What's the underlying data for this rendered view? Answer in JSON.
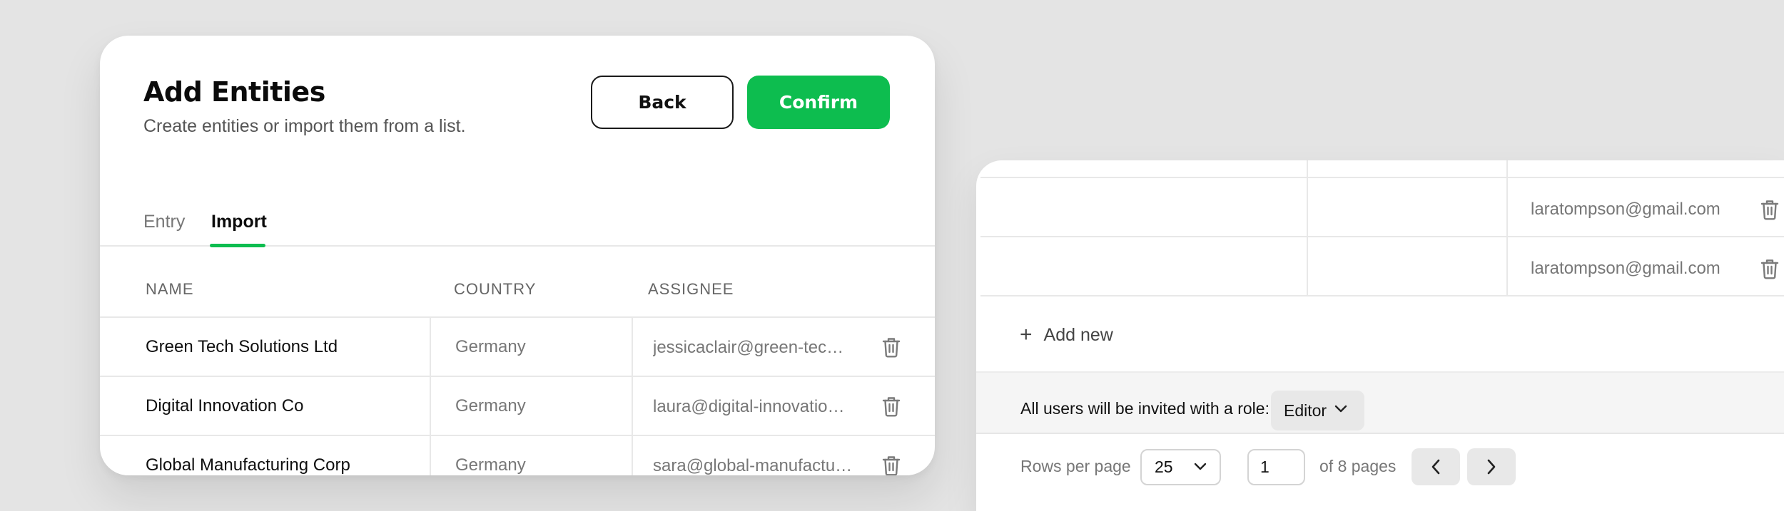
{
  "dialog": {
    "title": "Add Entities",
    "subtitle": "Create entities or import them from a list.",
    "back_label": "Back",
    "confirm_label": "Confirm",
    "tabs": [
      {
        "label": "Entry",
        "active": false
      },
      {
        "label": "Import",
        "active": true
      }
    ],
    "columns": [
      "NAME",
      "COUNTRY",
      "ASSIGNEE"
    ],
    "rows": [
      {
        "name": "Green Tech Solutions Ltd",
        "country": "Germany",
        "assignee": "jessicaclair@green-tech.com"
      },
      {
        "name": "Digital Innovation Co",
        "country": "Germany",
        "assignee": "laura@digital-innovation.com"
      },
      {
        "name": "Global Manufacturing Corp",
        "country": "Germany",
        "assignee": "sara@global-manufacturing.com"
      }
    ]
  },
  "invite_panel": {
    "rows": [
      {
        "email": "laratompson@gmail.com"
      },
      {
        "email": "laratompson@gmail.com"
      }
    ],
    "add_new_label": "Add new",
    "role_prompt": "All users will be invited with a role:",
    "role_value": "Editor",
    "pagination": {
      "rows_per_page_label": "Rows per page",
      "rows_per_page_value": "25",
      "current_page": "1",
      "of_pages_label": "of 8 pages"
    }
  },
  "colors": {
    "accent_green": "#0dbd4f",
    "background": "#e4e4e4"
  }
}
